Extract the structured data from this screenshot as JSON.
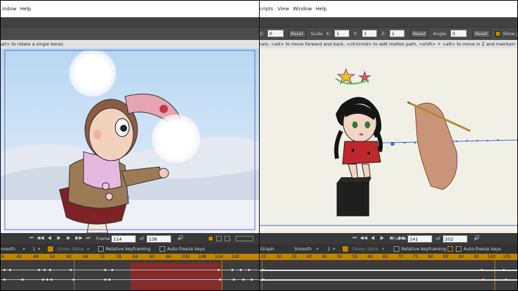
{
  "left": {
    "menu": [
      "indow",
      "Help"
    ],
    "hint": "alt> to rotate a single bone)",
    "frame_label": "Frame",
    "frame_value": "114",
    "of_label": "of",
    "total_frames": "138",
    "timeline": {
      "mode": "mooth",
      "count": "1",
      "onion_skins": "Onion Skins",
      "relative_keyframing": "Relative keyframing",
      "auto_freeze_keys": "Auto-freeze keys",
      "ruler": [
        "6",
        "42",
        "48",
        "54",
        "60",
        "66",
        "72",
        "78",
        "84",
        "90",
        "96",
        "102",
        "108",
        "114",
        "120"
      ]
    }
  },
  "right": {
    "menu": [
      "cripts",
      "View",
      "Window",
      "Help"
    ],
    "options": {
      "z_label": "Z:",
      "z_value": "0",
      "reset1": "Reset",
      "scale_label": "Scale",
      "x_label": "X:",
      "x_value": "1",
      "y_label": "Y:",
      "y_value": "1",
      "z2_label": "Z:",
      "z2_value": "1",
      "reset2": "Reset",
      "angle_label": "Angle:",
      "angle_value": "0",
      "reset3": "Reset",
      "show_label": "Show p"
    },
    "hint": "rain, <alt> to move forward and back, <ctrl/cmd> to edit motion path, <shift> + <alt> to move in Z and maintain visual size)",
    "frame_label": "Frame",
    "frame_value": "141",
    "of_label": "of",
    "total_frames": "202",
    "timeline": {
      "graph": "Graph",
      "mode": "Smooth",
      "count": "1",
      "onion_skins": "Onion Skins",
      "relative_keyframing": "Relative keyframing",
      "auto_freeze_keys": "Auto-freeze keys",
      "ruler": [
        "25",
        "30",
        "35",
        "40",
        "45",
        "50",
        "55",
        "60",
        "65",
        "70",
        "75",
        "80",
        "85",
        "90",
        "95",
        "100",
        "105"
      ]
    }
  },
  "colors": {
    "accent": "#c08400",
    "range": "#8a2a2a"
  }
}
